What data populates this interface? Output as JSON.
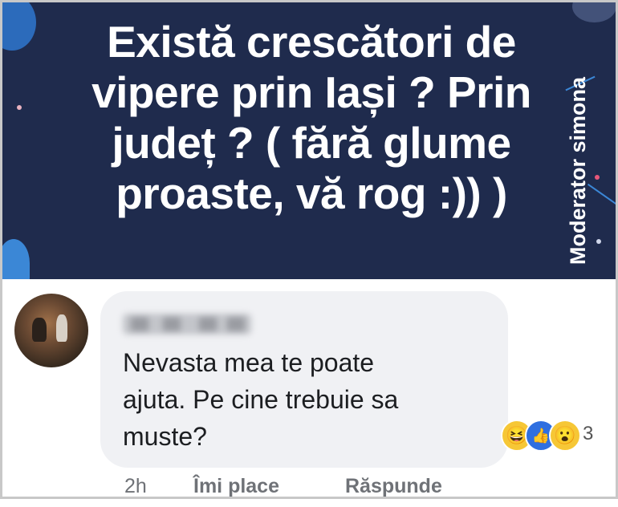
{
  "post": {
    "text_lines": [
      "Există crescători de",
      "vipere prin Iași ? Prin",
      "județ ? ( fără glume",
      "proaste, vă rog :)) )"
    ],
    "watermark": "Moderator simona",
    "background_color": "#1f2b4d"
  },
  "comment": {
    "author": "",
    "text_lines": [
      "Nevasta mea te poate",
      "ajuta. Pe cine trebuie sa",
      "muste?"
    ],
    "reactions": {
      "icons": [
        "haha-icon",
        "like-icon",
        "wow-icon"
      ],
      "count": "3"
    },
    "actions": {
      "time": "2h",
      "like_label": "Îmi place",
      "reply_label": "Răspunde"
    }
  }
}
